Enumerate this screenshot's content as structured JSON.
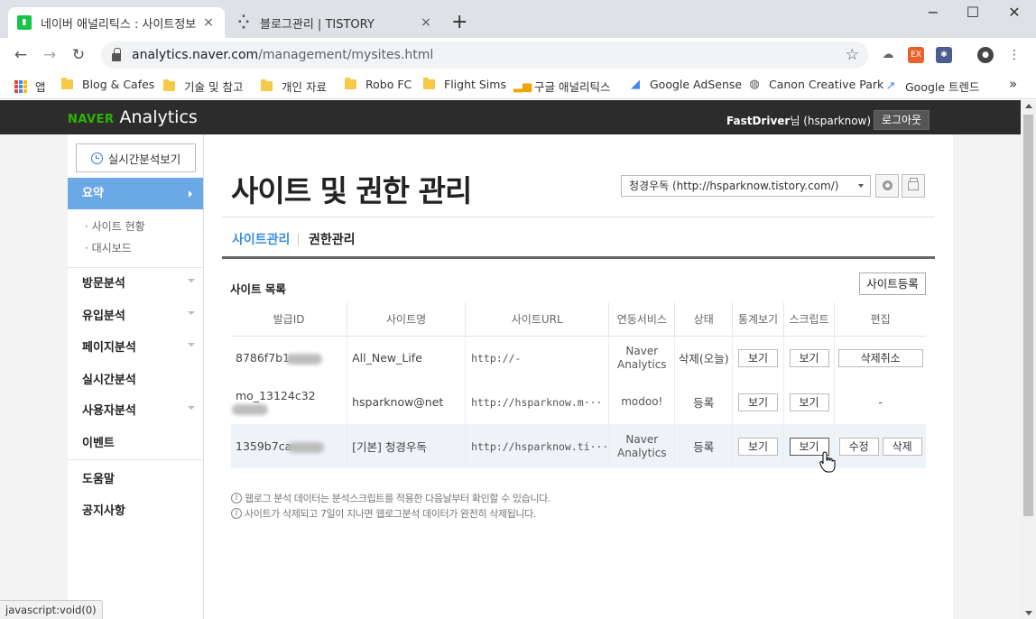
{
  "browser": {
    "tabs": [
      {
        "title": "네이버 애널리틱스 : 사이트정보",
        "close": "×"
      },
      {
        "title": "블로그관리 | TISTORY",
        "close": "×"
      }
    ],
    "new_tab": "+",
    "window": {
      "minimize": "−",
      "maximize": "☐",
      "close": "✕"
    },
    "nav": {
      "back": "←",
      "forward": "→",
      "reload": "↻"
    },
    "url_host": "analytics.naver.com",
    "url_path": "/management/mysites.html",
    "bookmarks": [
      {
        "label": "앱",
        "icon": "apps-grid"
      },
      {
        "label": "Blog & Cafes",
        "icon": "folder"
      },
      {
        "label": "기술 및 참고",
        "icon": "folder"
      },
      {
        "label": "개인 자료",
        "icon": "folder"
      },
      {
        "label": "Robo FC",
        "icon": "folder"
      },
      {
        "label": "Flight Sims",
        "icon": "folder"
      },
      {
        "label": "구글 애널리틱스",
        "icon": "analytics-bars"
      },
      {
        "label": "Google AdSense",
        "icon": "adsense"
      },
      {
        "label": "Canon Creative Park",
        "icon": "canon"
      },
      {
        "label": "Google 트렌드",
        "icon": "trends"
      }
    ],
    "more": "»",
    "status_text": "javascript:void(0)"
  },
  "header": {
    "logo_naver": "NAVER",
    "logo_analytics": "Analytics",
    "user_name": "FastDriver",
    "user_suffix": "님 (hsparknow)",
    "logout": "로그아웃"
  },
  "sidebar": {
    "realtime_button": "실시간분석보기",
    "active_menu": "요약",
    "submenu": [
      "· 사이트 현황",
      "· 대시보드"
    ],
    "menus": [
      {
        "label": "방문분석",
        "dropdown": true
      },
      {
        "label": "유입분석",
        "dropdown": true
      },
      {
        "label": "페이지분석",
        "dropdown": true
      },
      {
        "label": "실시간분석",
        "dropdown": false
      },
      {
        "label": "사용자분석",
        "dropdown": true
      },
      {
        "label": "이벤트",
        "dropdown": false
      }
    ],
    "footer_menus": [
      "도움말",
      "공지사항"
    ]
  },
  "main": {
    "title": "사이트 및 권한 관리",
    "site_select": "청경우독 (http://hsparknow.tistory.com/)",
    "tabs": [
      "사이트관리",
      "권한관리"
    ],
    "list_title": "사이트 목록",
    "add_button": "사이트등록",
    "columns": [
      "발급ID",
      "사이트명",
      "사이트URL",
      "연동서비스",
      "상태",
      "통계보기",
      "스크립트",
      "편집"
    ],
    "rows": [
      {
        "id": "8786f7b1",
        "name": "All_New_Life",
        "url": "http://-",
        "service": [
          "Naver",
          "Analytics"
        ],
        "status": "삭제(오늘)",
        "stats": "보기",
        "script": "보기",
        "edit": [
          "삭제취소"
        ]
      },
      {
        "id": "mo_13124c32",
        "name": "hsparknow@net",
        "url": "http://hsparknow.m···",
        "service": [
          "modoo!"
        ],
        "status": "등록",
        "stats": "보기",
        "script": "보기",
        "edit_text": "-"
      },
      {
        "id": "1359b7ca",
        "name": "[기본] 청경우독",
        "url": "http://hsparknow.ti···",
        "service": [
          "Naver",
          "Analytics"
        ],
        "status": "등록",
        "stats": "보기",
        "script": "보기",
        "edit": [
          "수정",
          "삭제"
        ]
      }
    ],
    "notes": [
      "웹로그 분석 데이터는 분석스크립트를 적용한 다음날부터 확인할 수 있습니다.",
      "사이트가 삭제되고 7일이 지나면 웹로그분석 데이터가 완전히 삭제됩니다."
    ]
  },
  "colors": {
    "naver_green": "#2db400",
    "accent_blue": "#3a8ede",
    "active_menu_bg": "#6aa8e6",
    "gnb_bg": "#2c2c2c"
  }
}
